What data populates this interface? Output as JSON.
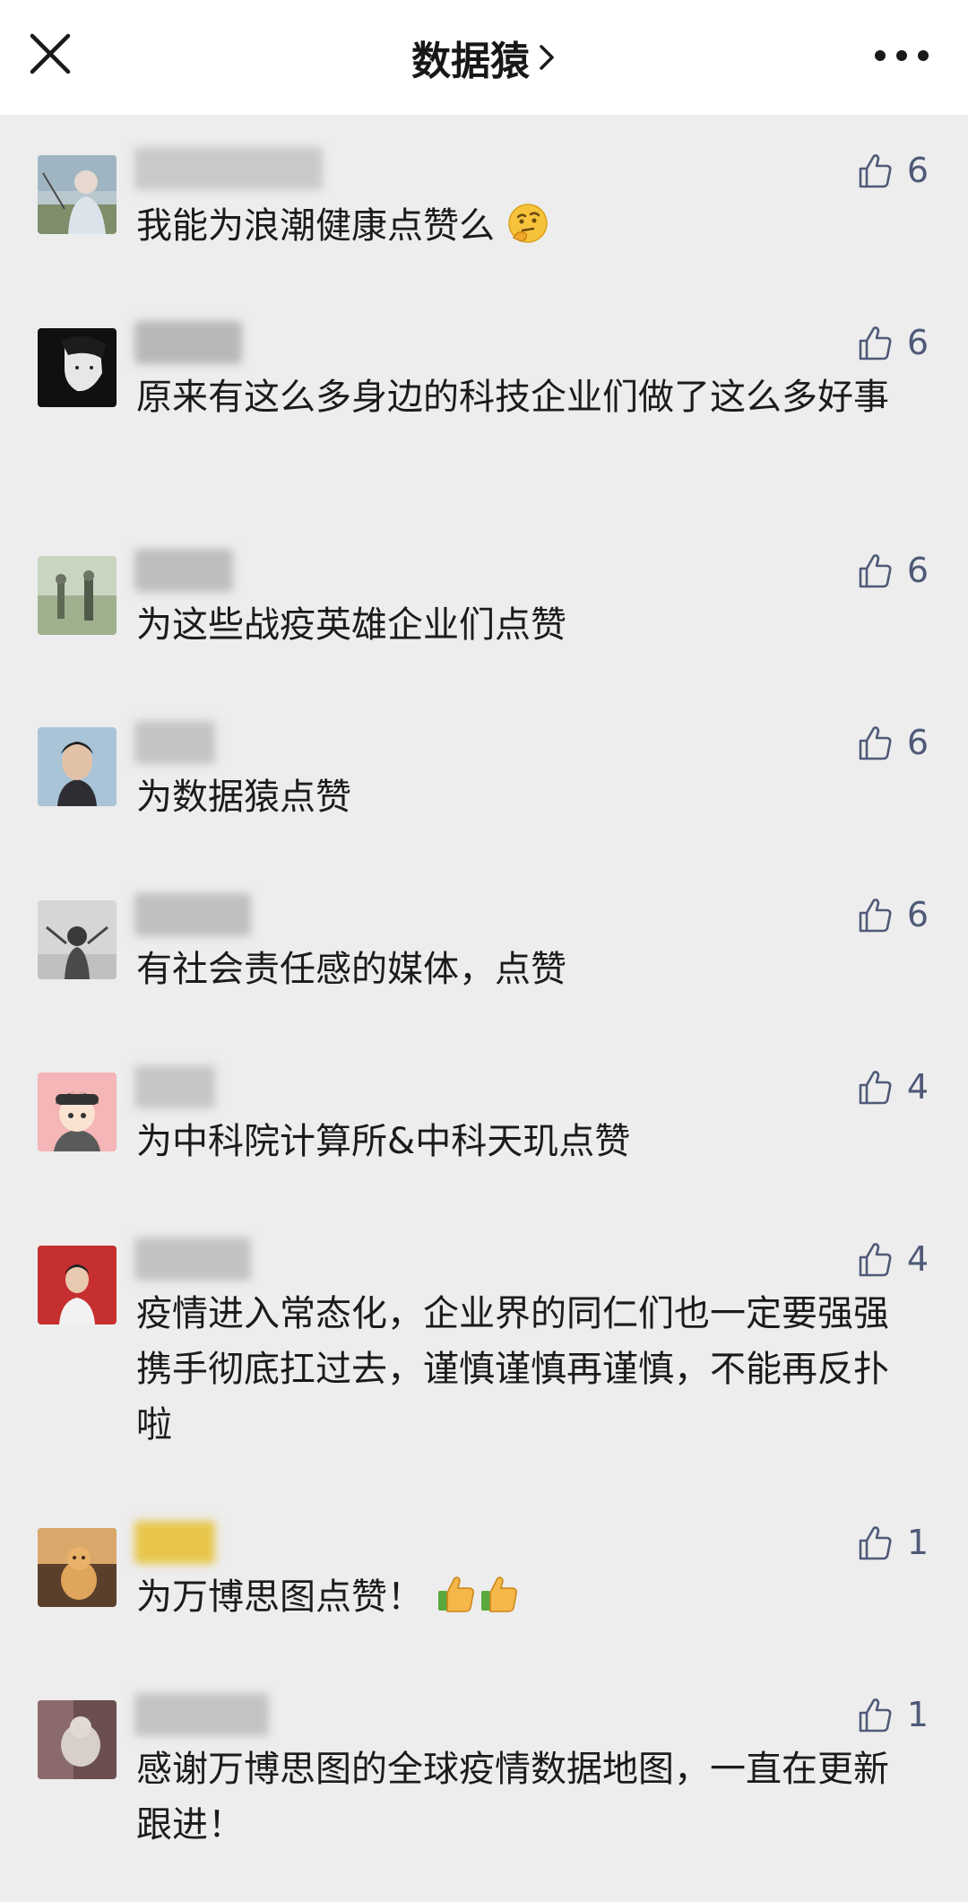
{
  "header": {
    "title": "数据猿"
  },
  "comments": [
    {
      "text": "我能为浪潮健康点赞么",
      "emoji": "thinking-face",
      "likes": "6"
    },
    {
      "text": "原来有这么多身边的科技企业们做了这么多好事",
      "likes": "6"
    },
    {
      "text": "为这些战疫英雄企业们点赞",
      "likes": "6"
    },
    {
      "text": "为数据猿点赞",
      "likes": "6"
    },
    {
      "text": "有社会责任感的媒体，点赞",
      "likes": "6"
    },
    {
      "text": "为中科院计算所&中科天玑点赞",
      "likes": "4"
    },
    {
      "text": "疫情进入常态化，企业界的同仁们也一定要强强携手彻底扛过去，谨慎谨慎再谨慎，不能再反扑啦",
      "likes": "4"
    },
    {
      "text": "为万博思图点赞！",
      "emoji": "thumbs-up-x2",
      "likes": "1"
    },
    {
      "text": "感谢万博思图的全球疫情数据地图，一直在更新跟进！",
      "likes": "1"
    }
  ],
  "colors": {
    "background": "#ededed",
    "header": "#ffffff",
    "like_icon": "#4f5a78"
  }
}
